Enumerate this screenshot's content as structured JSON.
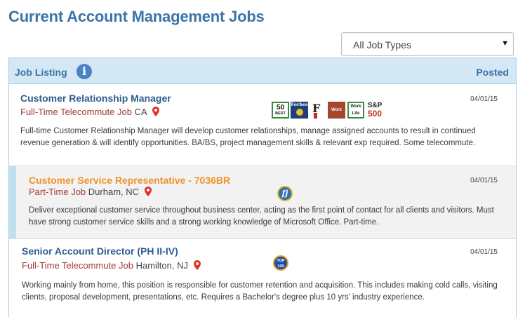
{
  "page": {
    "title": "Current Account Management Jobs"
  },
  "filter": {
    "selected": "All Job Types",
    "arrow_icon": "triangle-down-icon"
  },
  "listing_header": {
    "label": "Job Listing",
    "info_icon": "i",
    "posted_label": "Posted"
  },
  "jobs": [
    {
      "title": "Customer Relationship Manager",
      "type": "Full-Time Telecommute Job",
      "location": "CA",
      "date": "04/01/15",
      "description": "Full-time Customer Relationship Manager will develop customer relationships, manage assigned accounts to result in continued revenue generation & will identify opportunities. BA/BS, project management skills & relevant exp required. Some telecommute.",
      "badges": {
        "fifty_best_top": "50",
        "fifty_best_bottom": "BEST",
        "forbes": "Forbes",
        "fi": "F",
        "work_life_1": "Work",
        "work_life_2a": "Work",
        "work_life_2b": "Life",
        "sp_top": "S&P",
        "sp_bottom": "500"
      }
    },
    {
      "title": "Customer Service Representative - 7036BR",
      "type": "Part-Time Job",
      "location": "Durham, NC",
      "date": "04/01/15",
      "description": "Deliver exceptional customer service throughout business center, acting as the first point of contact for all clients and visitors. Must have strong customer service skills and a strong working knowledge of Microsoft Office. Part-time.",
      "badges": {
        "fj": "fj"
      }
    },
    {
      "title": "Senior Account Director (PH II-IV)",
      "type": "Full-Time Telecommute Job",
      "location": "Hamilton, NJ",
      "date": "04/01/15",
      "description": "Working mainly from home, this position is responsible for customer retention and acquisition. This includes making cold calls, visiting clients, proposal development, presentations, etc. Requires a Bachelor's degree plus 10 yrs' industry experience.",
      "badges": {
        "top100_a": "TOP",
        "top100_b": "100"
      }
    }
  ],
  "colors": {
    "title_blue": "#3b74a8",
    "job_title_blue": "#2e5d8e",
    "job_title_orange": "#f0912a",
    "job_type_red": "#a33a3a",
    "header_bg": "#d3e8f4",
    "pin_red": "#e0312b"
  }
}
